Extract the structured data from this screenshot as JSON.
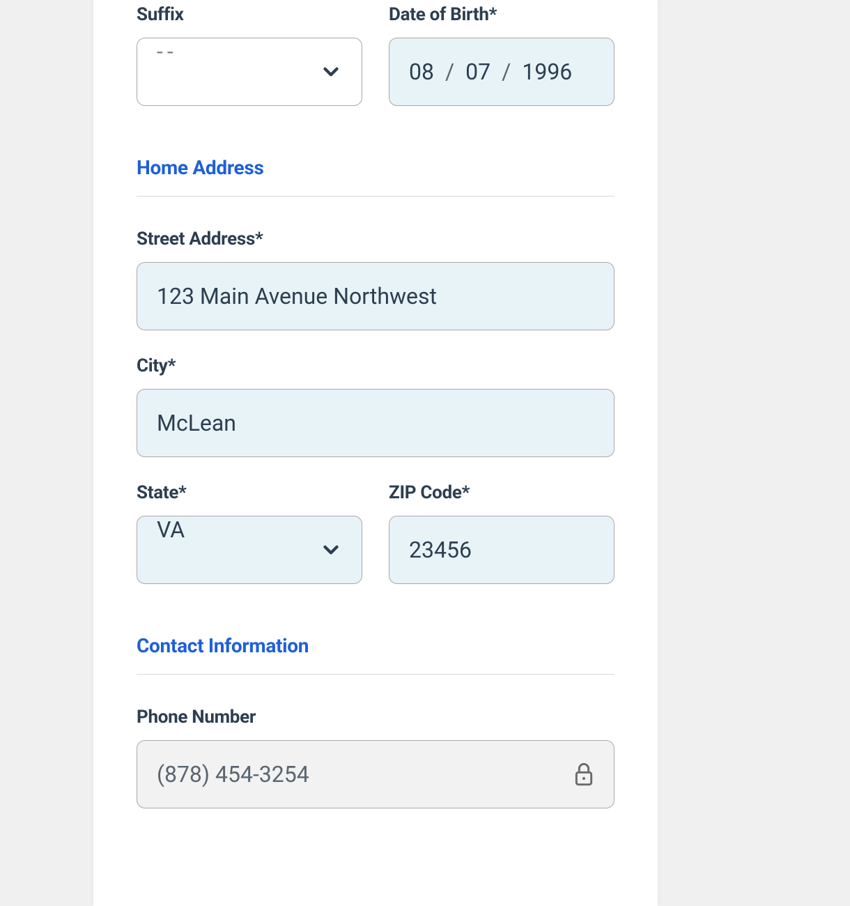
{
  "personal": {
    "suffix": {
      "label": "Suffix",
      "placeholder": "--",
      "value": ""
    },
    "dob": {
      "label": "Date of Birth*",
      "month": "08",
      "day": "07",
      "year": "1996",
      "separator": "/"
    }
  },
  "sections": {
    "home_address": "Home Address",
    "contact_info": "Contact Information"
  },
  "address": {
    "street": {
      "label": "Street Address*",
      "value": "123 Main Avenue Northwest"
    },
    "city": {
      "label": "City*",
      "value": "McLean"
    },
    "state": {
      "label": "State*",
      "value": "VA"
    },
    "zip": {
      "label": "ZIP Code*",
      "value": "23456"
    }
  },
  "contact": {
    "phone": {
      "label": "Phone Number",
      "value": "(878) 454-3254"
    }
  }
}
